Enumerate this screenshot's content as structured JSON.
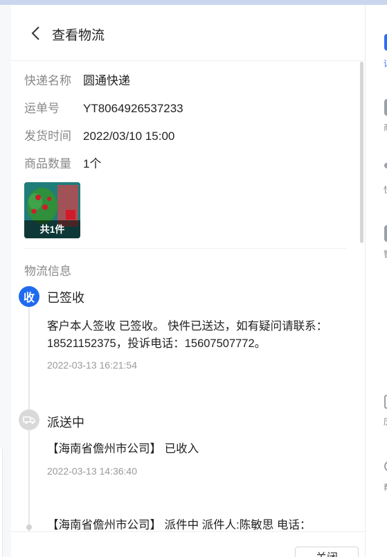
{
  "header": {
    "title": "查看物流"
  },
  "info": {
    "courier_label": "快递名称",
    "courier_value": "圆通快递",
    "waybill_label": "运单号",
    "waybill_value": "YT8064926537233",
    "ship_time_label": "发货时间",
    "ship_time_value": "2022/03/10 15:00",
    "qty_label": "商品数量",
    "qty_value": "1个"
  },
  "product": {
    "caption": "共1件"
  },
  "logistics": {
    "section_title": "物流信息",
    "events": [
      {
        "node": "收",
        "status": "已签收",
        "desc_line1": "客户本人签收 已签收。 快件已送达，如有疑问请联系：",
        "desc_line2": "18521152375，投诉电话：15607507772。",
        "time": "2022-03-13 16:21:54"
      },
      {
        "node_icon": "delivery-truck-icon",
        "status": "派送中",
        "desc": "【海南省儋州市公司】 已收入",
        "time": "2022-03-13 14:36:40"
      },
      {
        "desc": "【海南省儋州市公司】 派件中 派件人:陈敏思 电话："
      }
    ]
  },
  "footer": {
    "close_label": "关闭"
  },
  "sidebar": {
    "items": [
      {
        "icon": "doc-icon",
        "label": "详"
      },
      {
        "icon": "product-icon",
        "label": "商"
      },
      {
        "icon": "quick-icon",
        "label": "快捷"
      },
      {
        "icon": "smart-icon",
        "label": "智能"
      },
      {
        "icon": "history-icon",
        "label": "历"
      },
      {
        "icon": "help-icon",
        "label": "帮"
      }
    ]
  },
  "colors": {
    "accent": "#1f6bf0",
    "node_gray": "#d9d9d9",
    "thumb_bg": "#1f7d7a"
  }
}
